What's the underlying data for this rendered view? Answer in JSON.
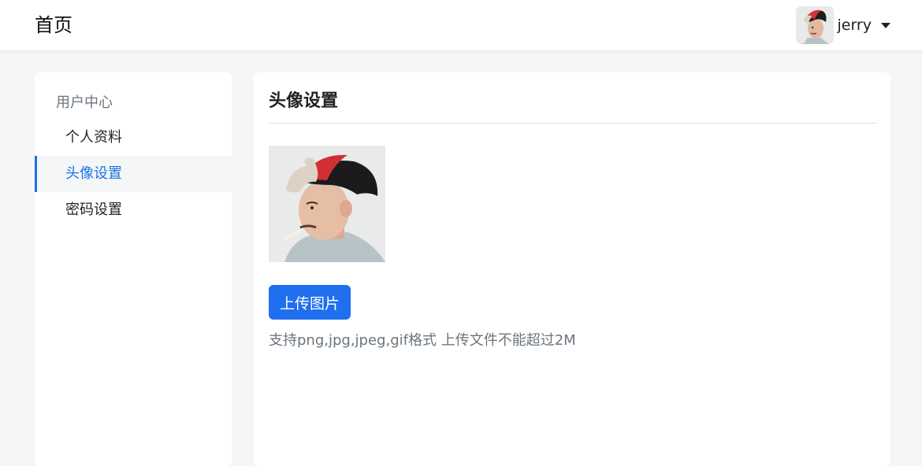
{
  "header": {
    "brand": "首页",
    "user": {
      "name": "jerry",
      "avatar_icon": "user-avatar-photo"
    }
  },
  "sidebar": {
    "heading": "用户中心",
    "items": [
      {
        "label": "个人资料",
        "active": false
      },
      {
        "label": "头像设置",
        "active": true
      },
      {
        "label": "密码设置",
        "active": false
      }
    ]
  },
  "main": {
    "title": "头像设置",
    "upload_label": "上传图片",
    "hint": "支持png,jpg,jpeg,gif格式 上传文件不能超过2M"
  },
  "colors": {
    "accent": "#1f6fef",
    "active_text": "#1a73e8",
    "muted_text": "#6c757d",
    "page_bg": "#f5f6f8"
  }
}
